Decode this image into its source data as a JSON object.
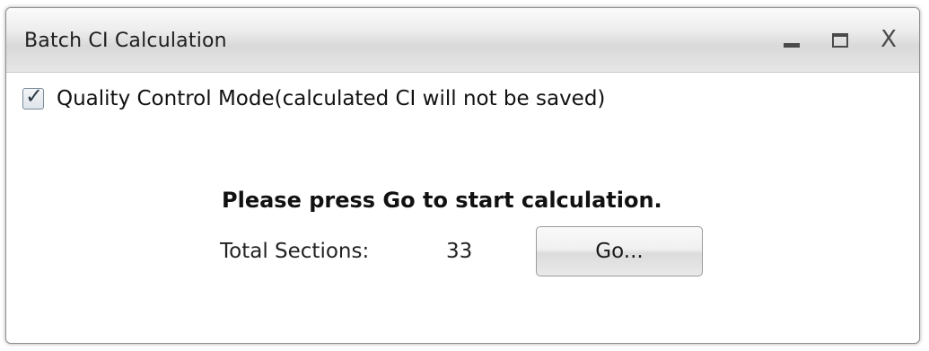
{
  "window": {
    "title": "Batch CI Calculation",
    "controls": {
      "minimize_icon": "minimize-icon",
      "maximize_icon": "maximize-icon",
      "close_glyph": "X"
    }
  },
  "qc_mode": {
    "checked": true,
    "label": "Quality Control Mode(calculated CI will not be saved)"
  },
  "main": {
    "message": "Please press Go to start calculation.",
    "total_label": "Total Sections:",
    "total_value": "33",
    "go_label": "Go..."
  }
}
